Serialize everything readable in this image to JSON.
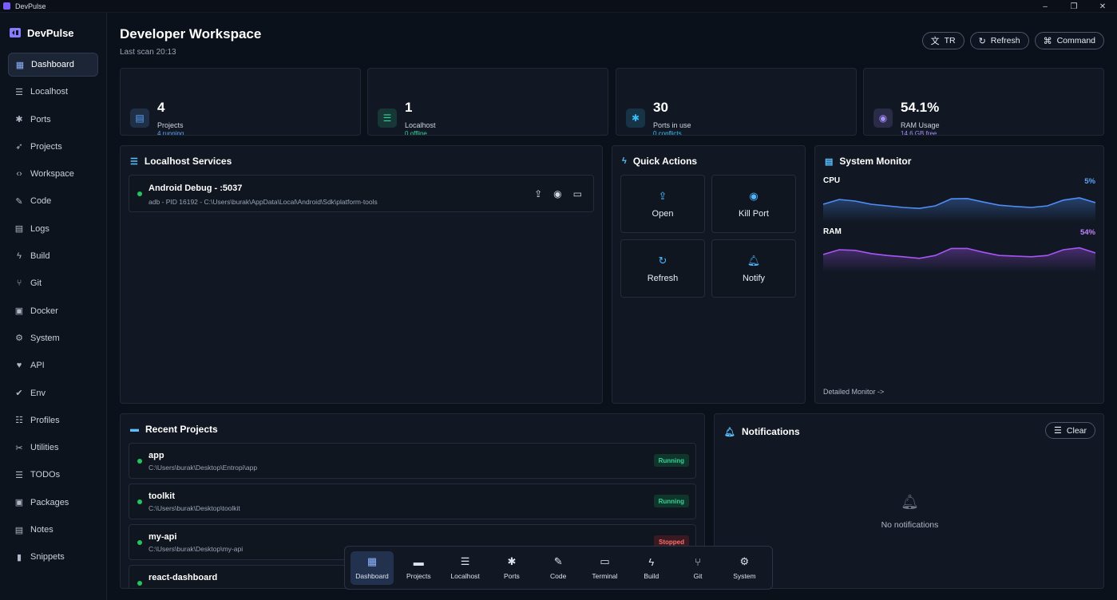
{
  "window": {
    "title": "DevPulse",
    "controls": [
      "–",
      "❐",
      "✕"
    ]
  },
  "sidebar": {
    "brand": "DevPulse",
    "items": [
      {
        "label": "Dashboard",
        "icon": "grid-icon",
        "glyph": "▦",
        "active": true
      },
      {
        "label": "Localhost",
        "icon": "server-icon",
        "glyph": "☰"
      },
      {
        "label": "Ports",
        "icon": "ports-icon",
        "glyph": "✱"
      },
      {
        "label": "Projects",
        "icon": "rocket-icon",
        "glyph": "➶"
      },
      {
        "label": "Workspace",
        "icon": "code-icon",
        "glyph": "‹›"
      },
      {
        "label": "Code",
        "icon": "edit-icon",
        "glyph": "✎"
      },
      {
        "label": "Logs",
        "icon": "logs-icon",
        "glyph": "▤"
      },
      {
        "label": "Build",
        "icon": "bolt-icon",
        "glyph": "ϟ"
      },
      {
        "label": "Git",
        "icon": "git-icon",
        "glyph": "⑂"
      },
      {
        "label": "Docker",
        "icon": "docker-icon",
        "glyph": "▣"
      },
      {
        "label": "System",
        "icon": "system-icon",
        "glyph": "⚙"
      },
      {
        "label": "API",
        "icon": "heart-icon",
        "glyph": "♥"
      },
      {
        "label": "Env",
        "icon": "check-icon",
        "glyph": "✔"
      },
      {
        "label": "Profiles",
        "icon": "sliders-icon",
        "glyph": "☷"
      },
      {
        "label": "Utilities",
        "icon": "tools-icon",
        "glyph": "✂"
      },
      {
        "label": "TODOs",
        "icon": "list-icon",
        "glyph": "☰"
      },
      {
        "label": "Packages",
        "icon": "package-icon",
        "glyph": "▣"
      },
      {
        "label": "Notes",
        "icon": "note-icon",
        "glyph": "▤"
      },
      {
        "label": "Snippets",
        "icon": "snippet-icon",
        "glyph": "▮"
      }
    ]
  },
  "header": {
    "title": "Developer Workspace",
    "subtitle": "Last scan 20:13",
    "buttons": {
      "lang": "TR",
      "refresh": "Refresh",
      "command": "Command"
    }
  },
  "stats": [
    {
      "value": "4",
      "label": "Projects",
      "sub": "4 running",
      "color": "#60a5fa",
      "glyph": "▤"
    },
    {
      "value": "1",
      "label": "Localhost",
      "sub": "0 offline",
      "color": "#34d399",
      "glyph": "☰"
    },
    {
      "value": "30",
      "label": "Ports in use",
      "sub": "0 conflicts",
      "color": "#38bdf8",
      "glyph": "✱"
    },
    {
      "value": "54.1%",
      "label": "RAM Usage",
      "sub": "14.6 GB free",
      "color": "#a78bfa",
      "glyph": "◉"
    }
  ],
  "localhost": {
    "title": "Localhost Services",
    "service": {
      "name": "Android Debug - :5037",
      "detail": "adb - PID 16192 - C:\\Users\\burak\\AppData\\Local\\Android\\Sdk\\platform-tools"
    }
  },
  "quick_actions": {
    "title": "Quick Actions",
    "items": [
      {
        "label": "Open",
        "glyph": "⇪"
      },
      {
        "label": "Kill Port",
        "glyph": "◉"
      },
      {
        "label": "Refresh",
        "glyph": "↻"
      },
      {
        "label": "Notify",
        "glyph": "🔔︎"
      }
    ]
  },
  "monitor": {
    "title": "System Monitor",
    "cpu_label": "CPU",
    "cpu_value": "5%",
    "ram_label": "RAM",
    "ram_value": "54%",
    "link": "Detailed Monitor ->",
    "cpu_series": [
      0.55,
      0.7,
      0.65,
      0.55,
      0.5,
      0.45,
      0.42,
      0.5,
      0.72,
      0.73,
      0.62,
      0.52,
      0.48,
      0.45,
      0.5,
      0.68,
      0.75,
      0.6
    ],
    "ram_series": [
      0.55,
      0.7,
      0.68,
      0.58,
      0.52,
      0.48,
      0.43,
      0.52,
      0.74,
      0.74,
      0.62,
      0.52,
      0.5,
      0.48,
      0.52,
      0.7,
      0.76,
      0.6
    ],
    "cpu_color": "#4f8ef7",
    "ram_color": "#a855f7"
  },
  "recent": {
    "title": "Recent Projects",
    "items": [
      {
        "name": "app",
        "path": "C:\\Users\\burak\\Desktop\\Entropi\\app",
        "status": "Running",
        "state": "run"
      },
      {
        "name": "toolkit",
        "path": "C:\\Users\\burak\\Desktop\\toolkit",
        "status": "Running",
        "state": "run"
      },
      {
        "name": "my-api",
        "path": "C:\\Users\\burak\\Desktop\\my-api",
        "status": "Stopped",
        "state": "stop"
      },
      {
        "name": "react-dashboard",
        "path": "",
        "status": "",
        "state": "run"
      }
    ]
  },
  "notifications": {
    "title": "Notifications",
    "clear": "Clear",
    "empty": "No notifications"
  },
  "dock": {
    "items": [
      {
        "label": "Dashboard",
        "glyph": "▦",
        "active": true
      },
      {
        "label": "Projects",
        "glyph": "▬"
      },
      {
        "label": "Localhost",
        "glyph": "☰"
      },
      {
        "label": "Ports",
        "glyph": "✱"
      },
      {
        "label": "Code",
        "glyph": "✎"
      },
      {
        "label": "Terminal",
        "glyph": "▭"
      },
      {
        "label": "Build",
        "glyph": "ϟ"
      },
      {
        "label": "Git",
        "glyph": "⑂"
      },
      {
        "label": "System",
        "glyph": "⚙"
      }
    ]
  }
}
